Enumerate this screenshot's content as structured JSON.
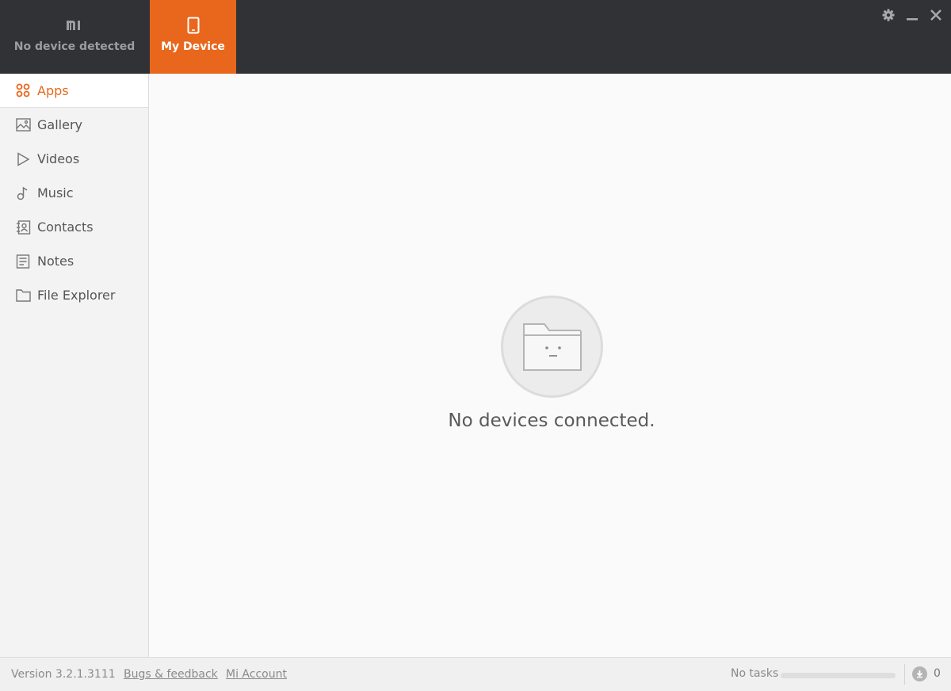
{
  "topbar": {
    "device_tab_label": "No device detected",
    "device_tab_icon": "mi-logo-icon",
    "my_device_tab_label": "My Device",
    "my_device_tab_icon": "phone-icon",
    "accent_color": "#e8671c",
    "window_controls": [
      "settings-icon",
      "minimize-icon",
      "close-icon"
    ]
  },
  "sidebar": {
    "items": [
      {
        "label": "Apps",
        "icon": "apps-icon",
        "active": true
      },
      {
        "label": "Gallery",
        "icon": "image-icon",
        "active": false
      },
      {
        "label": "Videos",
        "icon": "play-icon",
        "active": false
      },
      {
        "label": "Music",
        "icon": "music-note-icon",
        "active": false
      },
      {
        "label": "Contacts",
        "icon": "contacts-icon",
        "active": false
      },
      {
        "label": "Notes",
        "icon": "notes-icon",
        "active": false
      },
      {
        "label": "File Explorer",
        "icon": "folder-icon",
        "active": false
      }
    ]
  },
  "main": {
    "empty_icon": "sad-folder-icon",
    "empty_message": "No devices connected."
  },
  "statusbar": {
    "version": "Version 3.2.1.3111",
    "bugs_link": "Bugs & feedback",
    "account_link": "Mi Account",
    "tasks_text": "No tasks",
    "task_progress": 0,
    "download_count": "0",
    "download_icon": "download-icon"
  }
}
